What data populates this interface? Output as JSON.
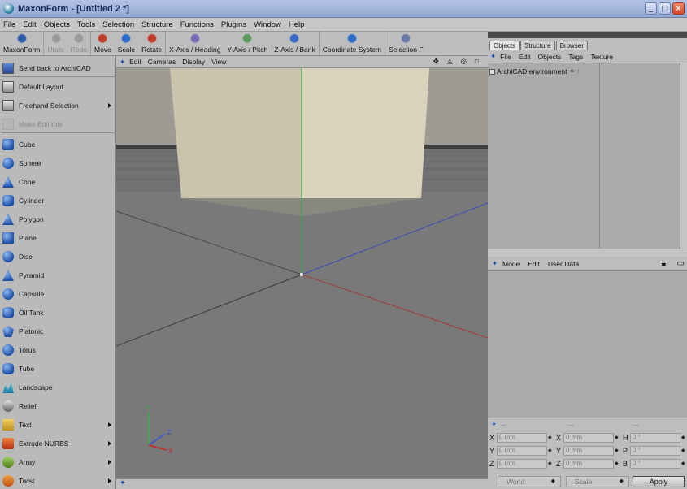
{
  "window": {
    "title": "MaxonForm - [Untitled 2 *]"
  },
  "menu": [
    "File",
    "Edit",
    "Objects",
    "Tools",
    "Selection",
    "Structure",
    "Functions",
    "Plugins",
    "Window",
    "Help"
  ],
  "toolbar": [
    {
      "label": "MaxonForm",
      "icon": "maxonform-icon",
      "disabled": false
    },
    {
      "label": "Undo",
      "icon": "undo-icon",
      "disabled": true
    },
    {
      "label": "Redo",
      "icon": "redo-icon",
      "disabled": true
    },
    {
      "label": "Move",
      "icon": "move-icon",
      "disabled": false
    },
    {
      "label": "Scale",
      "icon": "scale-icon",
      "disabled": false
    },
    {
      "label": "Rotate",
      "icon": "rotate-icon",
      "disabled": false
    },
    {
      "label": "X-Axis / Heading",
      "icon": "x-axis-icon",
      "disabled": false
    },
    {
      "label": "Y-Axis / Pitch",
      "icon": "y-axis-icon",
      "disabled": false
    },
    {
      "label": "Z-Axis / Bank",
      "icon": "z-axis-icon",
      "disabled": false
    },
    {
      "label": "Coordinate System",
      "icon": "coordinate-system-icon",
      "disabled": false
    },
    {
      "label": "Selection F",
      "icon": "selection-filter-icon",
      "disabled": false
    }
  ],
  "palette": {
    "top": [
      {
        "label": "Send back to ArchiCAD",
        "icon": "send-back-icon",
        "disabled": false
      },
      {
        "label": "Default Layout",
        "icon": "layout-icon",
        "disabled": false
      },
      {
        "label": "Freehand Selection",
        "icon": "freehand-selection-icon",
        "disabled": false,
        "submenu": true
      },
      {
        "label": "Make Editable",
        "icon": "make-editable-icon",
        "disabled": true
      }
    ],
    "objects": [
      {
        "label": "Cube",
        "icon": "cube-icon"
      },
      {
        "label": "Sphere",
        "icon": "sphere-icon"
      },
      {
        "label": "Cone",
        "icon": "cone-icon"
      },
      {
        "label": "Cylinder",
        "icon": "cylinder-icon"
      },
      {
        "label": "Polygon",
        "icon": "polygon-icon"
      },
      {
        "label": "Plane",
        "icon": "plane-icon"
      },
      {
        "label": "Disc",
        "icon": "disc-icon"
      },
      {
        "label": "Pyramid",
        "icon": "pyramid-icon"
      },
      {
        "label": "Capsule",
        "icon": "capsule-icon"
      },
      {
        "label": "Oil Tank",
        "icon": "oil-tank-icon"
      },
      {
        "label": "Platonic",
        "icon": "platonic-icon"
      },
      {
        "label": "Torus",
        "icon": "torus-icon"
      },
      {
        "label": "Tube",
        "icon": "tube-icon"
      },
      {
        "label": "Landscape",
        "icon": "landscape-icon"
      },
      {
        "label": "Relief",
        "icon": "relief-icon"
      },
      {
        "label": "Text",
        "icon": "text-icon",
        "submenu": true
      },
      {
        "label": "Extrude NURBS",
        "icon": "extrude-nurbs-icon",
        "submenu": true
      },
      {
        "label": "Array",
        "icon": "array-icon",
        "submenu": true
      },
      {
        "label": "Twist",
        "icon": "twist-icon",
        "submenu": true
      }
    ]
  },
  "viewport": {
    "menu": [
      "Edit",
      "Cameras",
      "Display",
      "View"
    ],
    "axes": {
      "y": "Y",
      "z": "Z",
      "x": "X"
    }
  },
  "objects_manager": {
    "tabs": [
      "Objects",
      "Structure",
      "Browser"
    ],
    "menu": [
      "File",
      "Edit",
      "Objects",
      "Tags",
      "Texture"
    ],
    "tree": [
      {
        "name": "ArchiCAD environment"
      }
    ]
  },
  "attributes_manager": {
    "menu": [
      "Mode",
      "Edit",
      "User Data"
    ]
  },
  "coordinates": {
    "headers": [
      "--",
      "--",
      "--"
    ],
    "rows": [
      [
        {
          "axis": "X",
          "value": "0 mm"
        },
        {
          "axis": "X",
          "value": "0 mm"
        },
        {
          "axis": "H",
          "value": "0 °"
        }
      ],
      [
        {
          "axis": "Y",
          "value": "0 mm"
        },
        {
          "axis": "Y",
          "value": "0 mm"
        },
        {
          "axis": "P",
          "value": "0 °"
        }
      ],
      [
        {
          "axis": "Z",
          "value": "0 mm"
        },
        {
          "axis": "Z",
          "value": "0 mm"
        },
        {
          "axis": "B",
          "value": "0 °"
        }
      ]
    ],
    "mode_select": "World",
    "type_select": "Scale",
    "apply_label": "Apply"
  },
  "colors": {
    "accent_blue": "#2f64c8",
    "axis_x": "#c22828",
    "axis_y": "#2ab84a",
    "axis_z": "#3a52d8"
  }
}
